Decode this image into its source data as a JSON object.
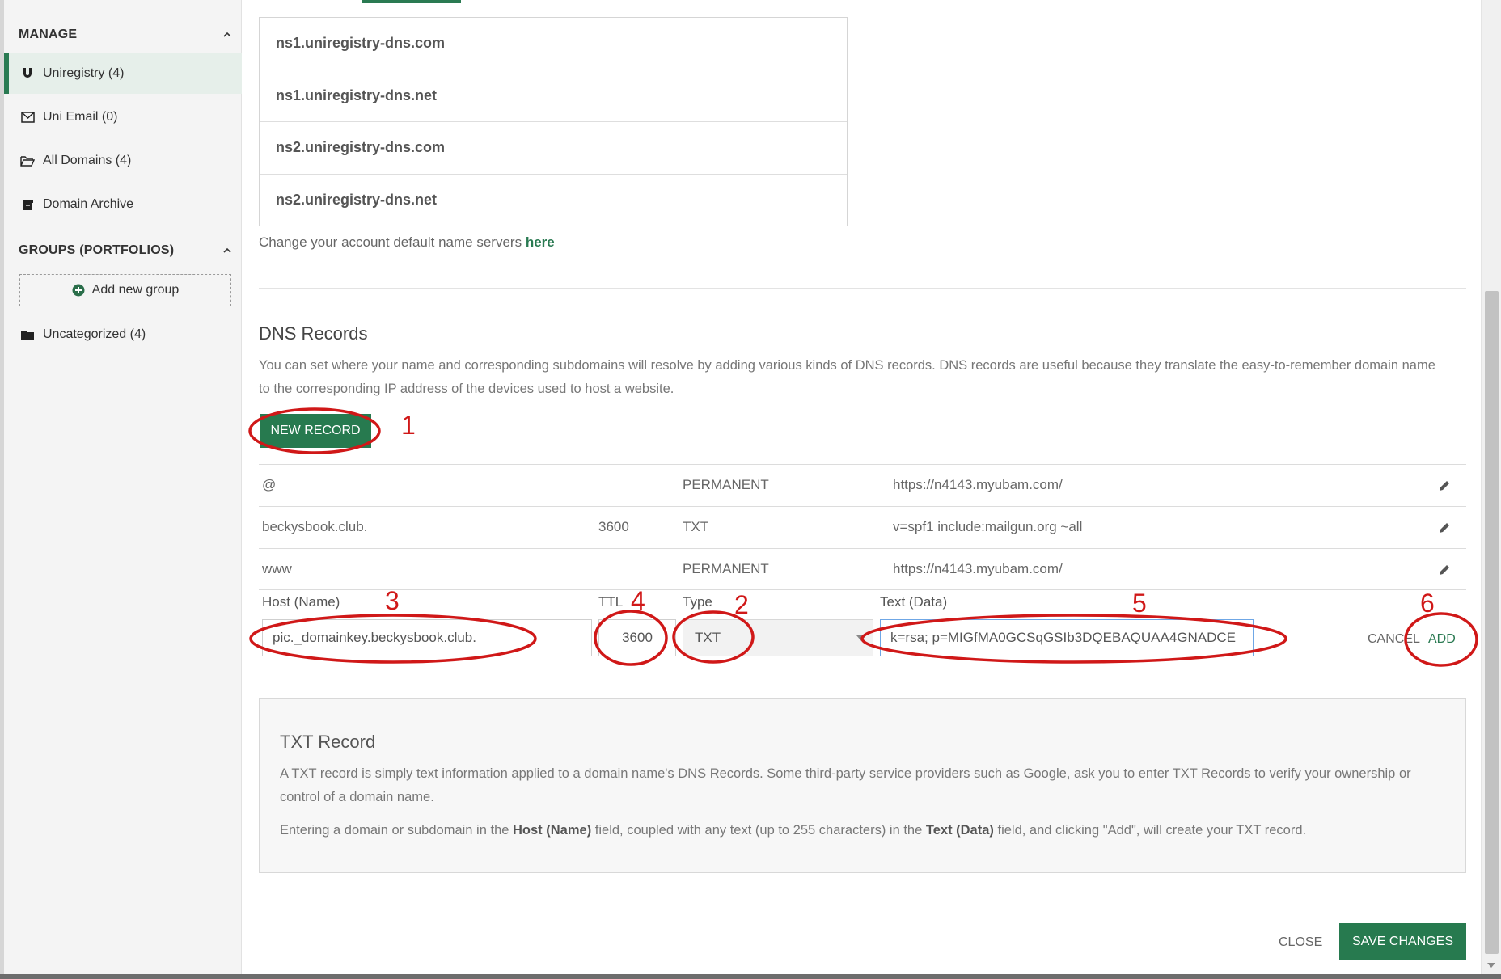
{
  "sidebar": {
    "manage_heading": "MANAGE",
    "items": [
      {
        "label": "Uniregistry (4)",
        "icon": "magnet-icon"
      },
      {
        "label": "Uni Email (0)",
        "icon": "mail-icon"
      },
      {
        "label": "All Domains (4)",
        "icon": "folder-open-icon"
      },
      {
        "label": "Domain Archive",
        "icon": "archive-icon"
      }
    ],
    "groups_heading": "GROUPS (PORTFOLIOS)",
    "add_group_label": "Add new group",
    "uncategorized_label": "Uncategorized (4)"
  },
  "nameservers": [
    "ns1.uniregistry-dns.com",
    "ns1.uniregistry-dns.net",
    "ns2.uniregistry-dns.com",
    "ns2.uniregistry-dns.net"
  ],
  "ns_note": {
    "text": "Change your account default name servers ",
    "link": "here"
  },
  "dns": {
    "title": "DNS Records",
    "description": "You can set where your name and corresponding subdomains will resolve by adding various kinds of DNS records. DNS records are useful because they translate the easy-to-remember domain name to the corresponding IP address of the devices used to host a website.",
    "new_record_label": "NEW RECORD",
    "records": [
      {
        "host": "@",
        "ttl": "",
        "type": "PERMANENT",
        "data": "https://n4143.myubam.com/"
      },
      {
        "host": "beckysbook.club.",
        "ttl": "3600",
        "type": "TXT",
        "data": "v=spf1 include:mailgun.org ~all"
      },
      {
        "host": "www",
        "ttl": "",
        "type": "PERMANENT",
        "data": "https://n4143.myubam.com/"
      }
    ],
    "form": {
      "host_label": "Host (Name)",
      "ttl_label": "TTL",
      "type_label": "Type",
      "data_label": "Text (Data)",
      "host_value": "pic._domainkey.beckysbook.club.",
      "ttl_value": "3600",
      "type_value": "TXT",
      "data_value": "k=rsa; p=MIGfMA0GCSqGSIb3DQEBAQUAA4GNADCE",
      "cancel_label": "CANCEL",
      "add_label": "ADD"
    }
  },
  "info": {
    "title": "TXT Record",
    "p1": "A TXT record is simply text information applied to a domain name's DNS Records. Some third-party service providers such as Google, ask you to enter TXT Records to verify your ownership or control of a domain name.",
    "p2_a": "Entering a domain or subdomain in the ",
    "p2_b": "Host (Name)",
    "p2_c": " field, coupled with any text (up to 255 characters) in the ",
    "p2_d": "Text (Data)",
    "p2_e": " field, and clicking \"Add\", will create your TXT record."
  },
  "footer": {
    "close_label": "CLOSE",
    "save_label": "SAVE CHANGES"
  },
  "annotations": [
    "1",
    "2",
    "3",
    "4",
    "5",
    "6"
  ],
  "colors": {
    "accent": "#277a4f",
    "annotation": "#d01818"
  }
}
